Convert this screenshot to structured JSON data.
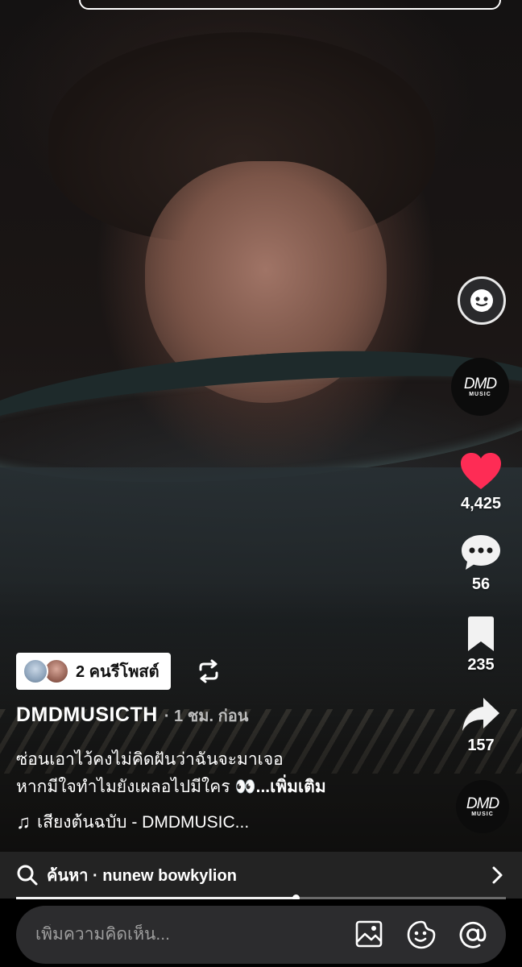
{
  "video": {
    "description_icon": "video-frame"
  },
  "right_rail": {
    "ai_icon": "ai-chat-icon",
    "creator_avatar": {
      "logo_main": "DMD",
      "logo_sub": "MUSIC"
    },
    "likes": "4,425",
    "comments": "56",
    "saves": "235",
    "shares": "157",
    "sound_avatar": {
      "logo_main": "DMD",
      "logo_sub": "MUSIC"
    },
    "like_color": "#fe2c55"
  },
  "repost_badge": {
    "label": "2 คนรีโพสต์"
  },
  "author": {
    "name": "DMDMUSICTH",
    "time": "· 1 ชม. ก่อน"
  },
  "caption": {
    "line1": "ซ่อนเอาไว้คงไม่คิดฝันว่าฉันจะมาเจอ",
    "line2": "หากมีใจทำไมยังเผลอไปมีใคร",
    "emoji": "👀",
    "more": "...เพิ่มเติม"
  },
  "music": {
    "label": "เสียงต้นฉบับ - DMDMUSIC..."
  },
  "search": {
    "label": "ค้นหา · nunew bowkylion"
  },
  "playback": {
    "progress": 0.57
  },
  "comment_bar": {
    "placeholder": "เพิ่มความคิดเห็น..."
  }
}
